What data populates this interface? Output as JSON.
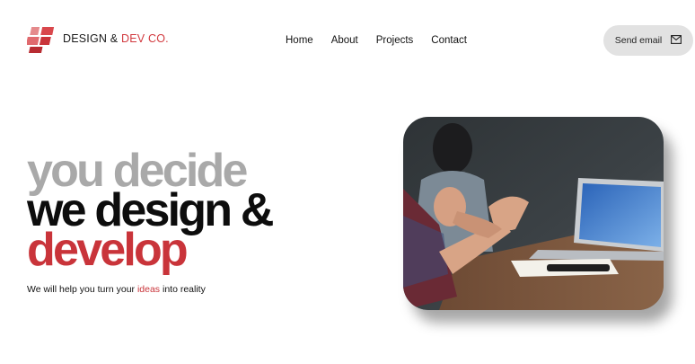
{
  "brand": {
    "name_part1": "DESIGN & ",
    "name_part2": "DEV CO."
  },
  "nav": {
    "items": [
      "Home",
      "About",
      "Projects",
      "Contact"
    ]
  },
  "send_button": {
    "label": "Send email",
    "icon": "mail-icon"
  },
  "hero": {
    "line1": "you decide",
    "line2": "we design &",
    "line3": "develop",
    "tagline_pre": "We will help you turn your ",
    "tagline_accent": "ideas",
    "tagline_post": " into reality"
  },
  "colors": {
    "accent": "#c9343a",
    "muted": "#a9a9a9",
    "button_bg": "#e2e2e2"
  }
}
